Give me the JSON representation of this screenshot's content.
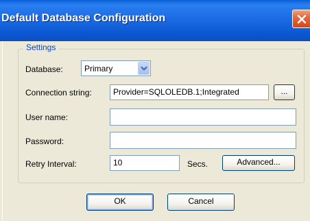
{
  "window": {
    "title": "Default Database Configuration",
    "close_icon": "close-x-icon"
  },
  "settings": {
    "group_label": "Settings",
    "database": {
      "label": "Database:",
      "value": "Primary"
    },
    "connection_string": {
      "label": "Connection string:",
      "value": "Provider=SQLOLEDB.1;Integrated",
      "browse_label": "..."
    },
    "user_name": {
      "label": "User name:",
      "value": ""
    },
    "password": {
      "label": "Password:",
      "value": ""
    },
    "retry_interval": {
      "label": "Retry Interval:",
      "value": "10",
      "unit": "Secs.",
      "advanced_label": "Advanced..."
    }
  },
  "buttons": {
    "ok": "OK",
    "cancel": "Cancel"
  },
  "colors": {
    "title_bar": "#0a5fd8",
    "close_button": "#d4461c",
    "dialog_bg": "#ece9d8",
    "group_label": "#0046d5"
  }
}
